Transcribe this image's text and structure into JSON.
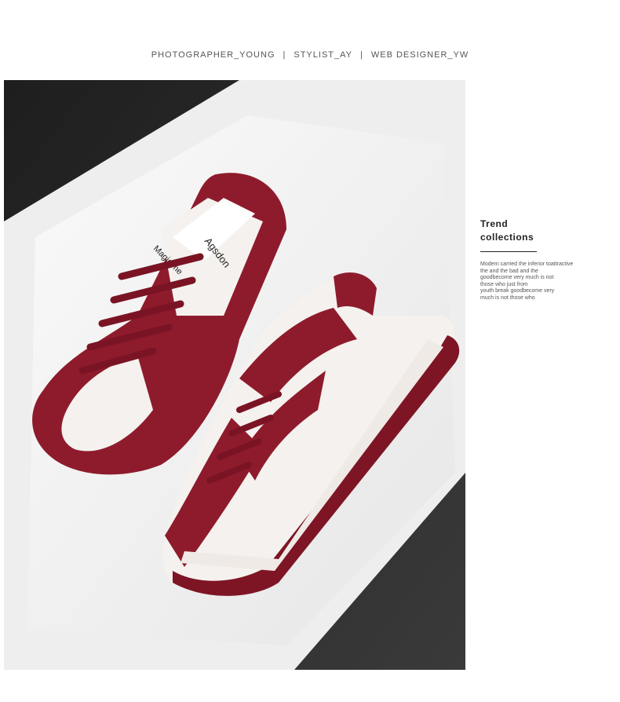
{
  "header": {
    "credits": [
      "PHOTOGRAPHER_YOUNG",
      "|",
      "STYLIST_AY",
      "|",
      "WEB   DESIGNER_YW"
    ]
  },
  "photo": {
    "brand_text": "Agsdon",
    "tongue_text": "Magicime",
    "colors": {
      "shoe_red": "#8e1b2c",
      "shoe_white": "#f4f1ee",
      "tray_white": "#f2f2f2",
      "background_dark": "#2b2b2b"
    }
  },
  "side_panel": {
    "title_line1": "Trend",
    "title_line2": "collections",
    "description_lines": [
      "Modern carried the inferior toattractive",
      "the and the bad and the",
      "goodbecome very much is not",
      "those who just from",
      "youth break goodbecome very",
      "much is not those who"
    ]
  }
}
